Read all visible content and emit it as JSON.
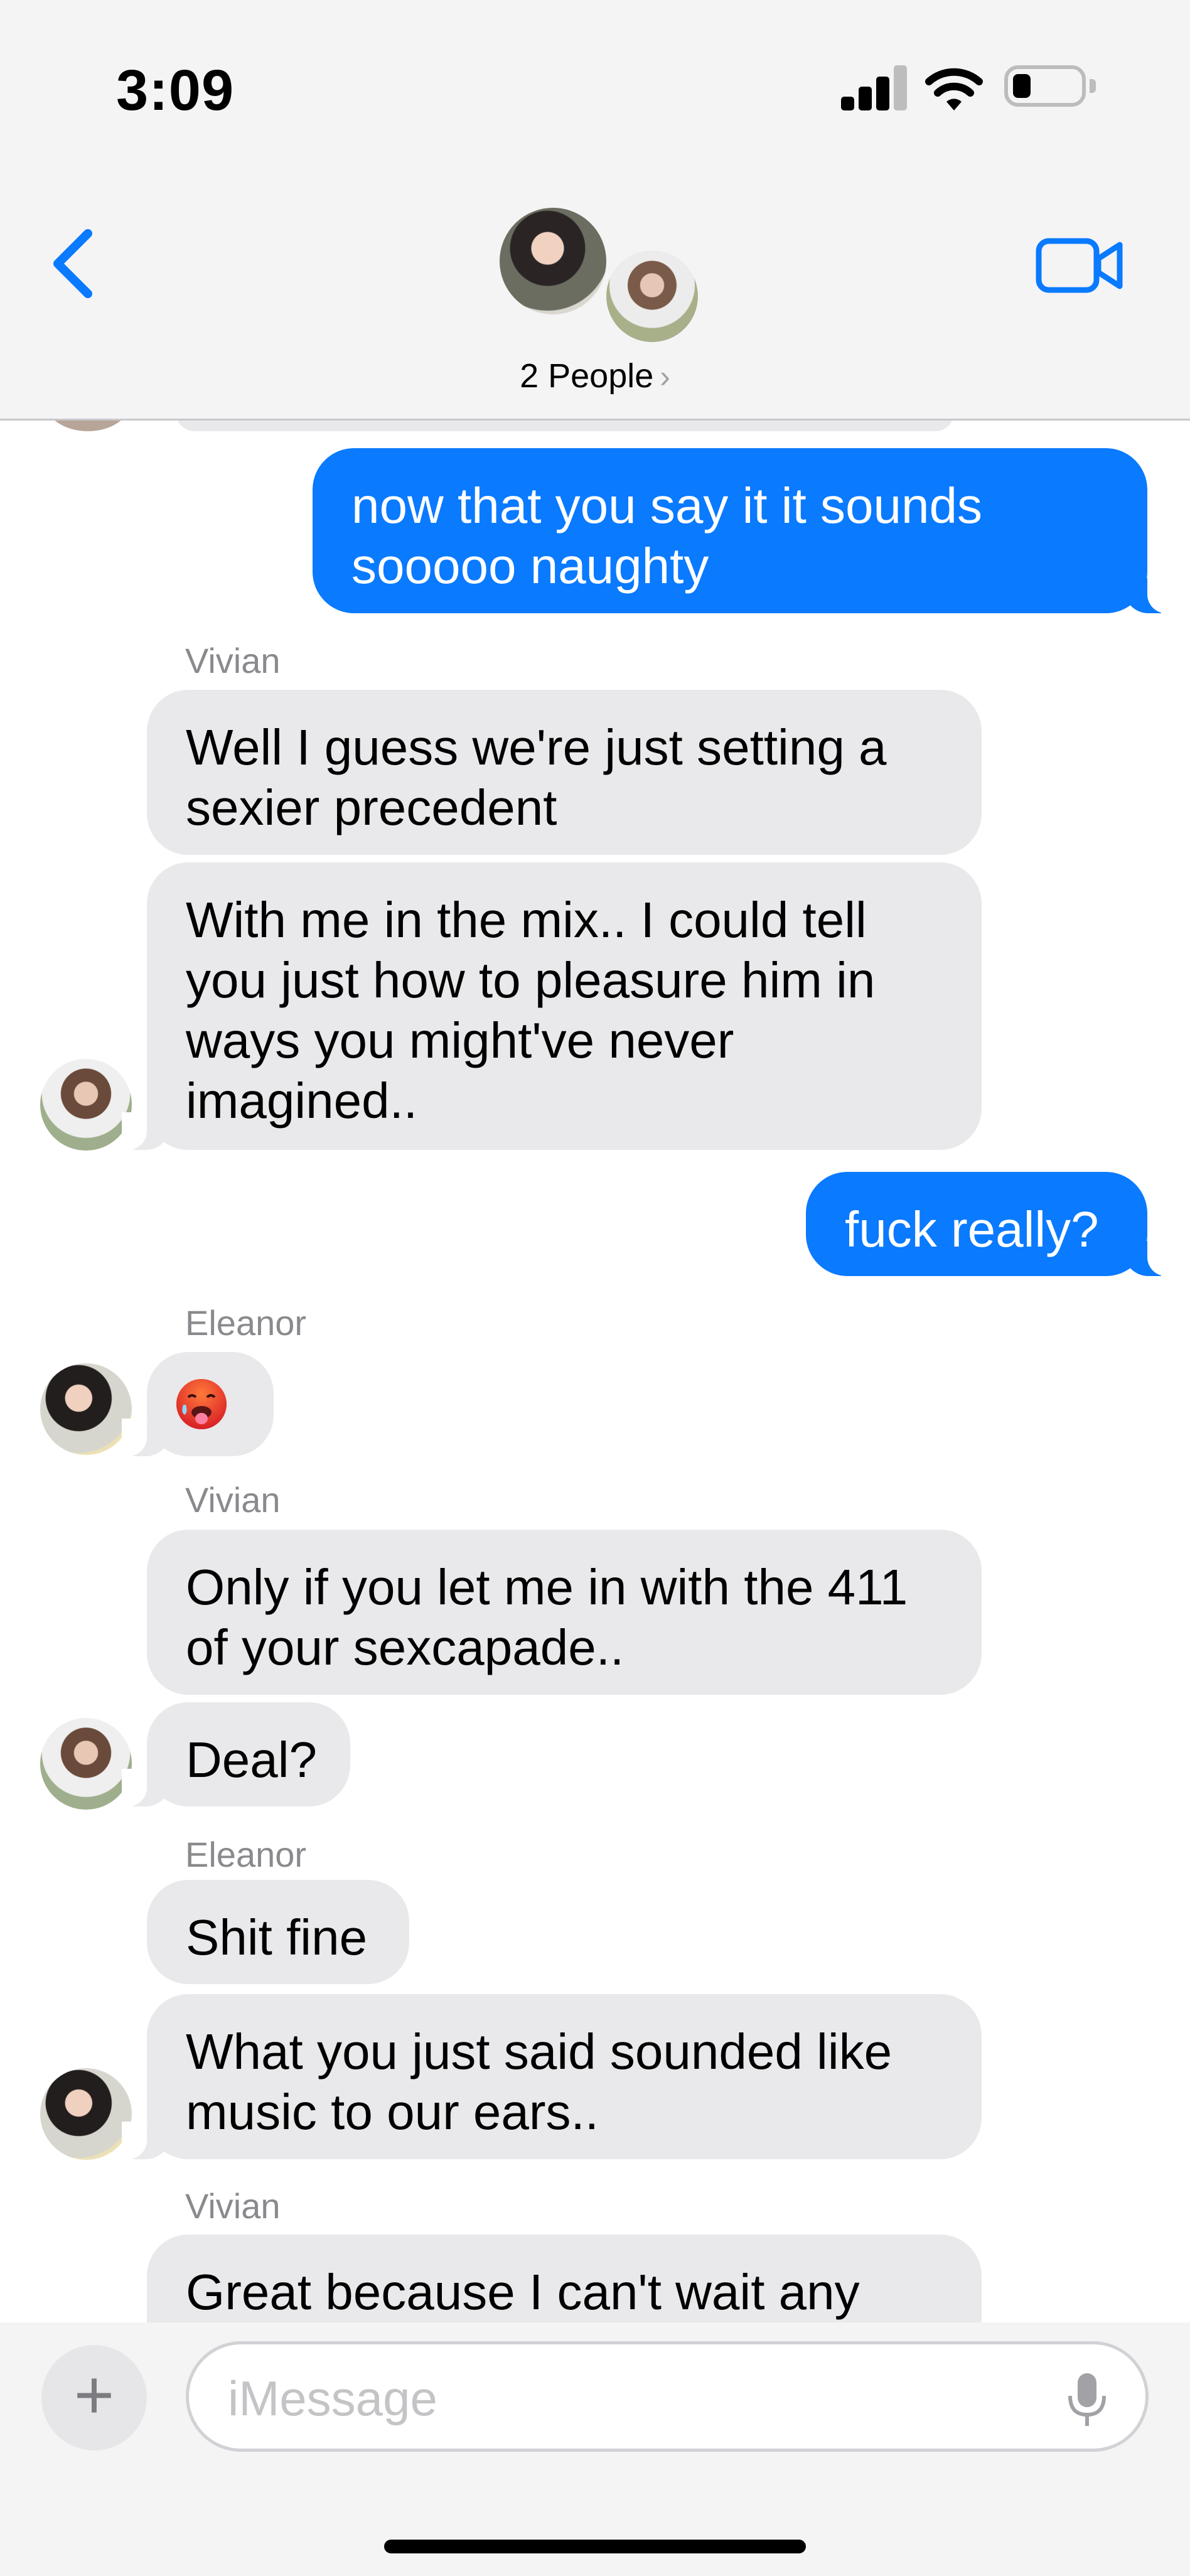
{
  "status_bar": {
    "time": "3:09"
  },
  "header": {
    "people_label": "2 People",
    "people_chevron": "›"
  },
  "messages": [
    {
      "from": "me",
      "text": "now that you say it it sounds sooooo naughty"
    },
    {
      "sender": "Vivian",
      "text": "Well I guess we're just setting a sexier precedent"
    },
    {
      "from": "Vivian",
      "text": "With me in the mix.. I could tell you just how to pleasure him in ways you might've never imagined.."
    },
    {
      "from": "me",
      "text": "fuck really?"
    },
    {
      "sender": "Eleanor",
      "text": "hot-face-emoji"
    },
    {
      "sender": "Vivian",
      "text": "Only if you let me in with the 411 of your sexcapade.."
    },
    {
      "from": "Vivian",
      "text": "Deal?"
    },
    {
      "sender": "Eleanor",
      "text": "Shit fine"
    },
    {
      "from": "Eleanor",
      "text": "What you just said sounded like music to our ears.."
    },
    {
      "sender": "Vivian",
      "text": "Great because I can't wait any"
    }
  ],
  "composer": {
    "plus_label": "+",
    "placeholder": "iMessage"
  },
  "colors": {
    "outgoing": "#0a7aff",
    "incoming": "#e9e9eb",
    "accent": "#0a7aff"
  }
}
